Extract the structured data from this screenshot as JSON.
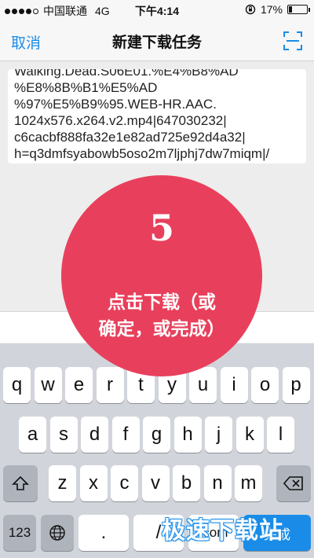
{
  "status_bar": {
    "carrier": "中国联通",
    "network": "4G",
    "time": "下午4:14",
    "battery": "17%",
    "battery_level": 0.17
  },
  "nav": {
    "cancel_label": "取消",
    "title": "新建下载任务",
    "scan_icon": "scan-frame-icon"
  },
  "url_text": "Walking.Dead.S06E01.%E4%B8%AD\n%E8%8B%B1%E5%AD\n%97%E5%B9%95.WEB-HR.AAC.\n1024x576.x264.v2.mp4|647030232|\nc6cacbf888fa32e1e82ad725e92d4a32|\nh=q3dmfsyabowb5oso2m7ljphj7dw7miqm|/",
  "overlay": {
    "step": "5",
    "line1": "点击下载（或",
    "line2": "确定，或完成）",
    "color": "#e8405c"
  },
  "keyboard": {
    "row1": [
      "q",
      "w",
      "e",
      "r",
      "t",
      "y",
      "u",
      "i",
      "o",
      "p"
    ],
    "row2": [
      "a",
      "s",
      "d",
      "f",
      "g",
      "h",
      "j",
      "k",
      "l"
    ],
    "row3": [
      "z",
      "x",
      "c",
      "v",
      "b",
      "n",
      "m"
    ],
    "numbers_label": "123",
    "dot_label": ".",
    "slash_label": "/",
    "com_label": ".com",
    "done_label": "完成"
  },
  "watermark": "极速下载站",
  "accent_color": "#1a8ce8"
}
